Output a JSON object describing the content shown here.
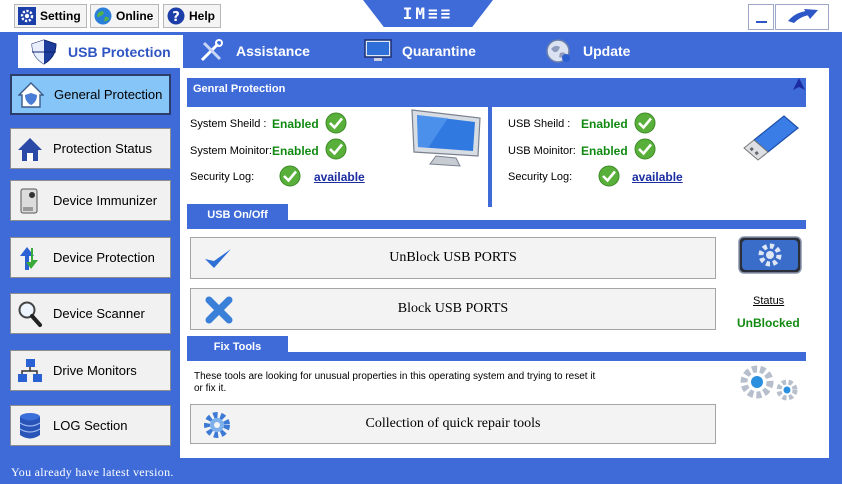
{
  "toolbar": {
    "setting_label": "Setting",
    "online_label": "Online",
    "help_label": "Help",
    "logo_text": "IM≡≡"
  },
  "tabs": [
    {
      "label": "USB Protection",
      "icon": "shield-icon"
    },
    {
      "label": "Assistance",
      "icon": "tools-icon"
    },
    {
      "label": "Quarantine",
      "icon": "monitor-icon"
    },
    {
      "label": "Update",
      "icon": "update-globe-icon"
    }
  ],
  "sidebar": {
    "items": [
      {
        "label": "General Protection",
        "icon": "house-shield-icon"
      },
      {
        "label": "Protection Status",
        "icon": "house-icon"
      },
      {
        "label": "Device Immunizer",
        "icon": "usb-drive-icon"
      },
      {
        "label": "Device Protection",
        "icon": "arrows-icon"
      },
      {
        "label": "Device Scanner",
        "icon": "magnifier-icon"
      },
      {
        "label": "Drive Monitors",
        "icon": "network-icon"
      },
      {
        "label": "LOG Section",
        "icon": "database-icon"
      }
    ]
  },
  "general": {
    "title": "Genral Protection",
    "system": {
      "shield_label": "System Sheild :",
      "shield_value": "Enabled",
      "monitor_label": "System Moinitor:",
      "monitor_value": "Enabled",
      "log_label": "Security Log:",
      "log_value": "available"
    },
    "usb": {
      "shield_label": "USB Sheild :",
      "shield_value": "Enabled",
      "monitor_label": "USB Moinitor:",
      "monitor_value": "Enabled",
      "log_label": "Security Log:",
      "log_value": "available"
    }
  },
  "usb_onoff": {
    "title": "USB On/Off",
    "unblock_label": "UnBlock USB PORTS",
    "block_label": "Block USB PORTS",
    "status_label": "Status",
    "status_value": "UnBlocked"
  },
  "fix_tools": {
    "title": "Fix Tools",
    "description": "These tools are looking for unusual properties in this operating system and trying to reset it or fix it.",
    "button_label": "Collection of quick repair tools"
  },
  "status_bar": {
    "message": "You already have latest version."
  },
  "colors": {
    "accent": "#3f6bd9",
    "enabled": "#128a12",
    "link": "#1a2ca0"
  }
}
